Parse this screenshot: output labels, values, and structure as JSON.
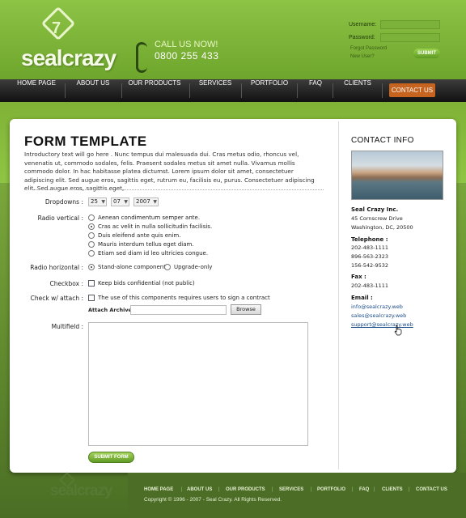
{
  "brand": {
    "name": "sealcrazy",
    "logo_glyph": "7"
  },
  "call": {
    "label": "CALL US NOW!",
    "number": "0800 255 433"
  },
  "login": {
    "username_label": "Username:",
    "password_label": "Password:",
    "forgot": "Forgot Password",
    "new_user": "New User?",
    "submit": "SUBMIT"
  },
  "nav": {
    "items": [
      {
        "label": "HOME PAGE"
      },
      {
        "label": "ABOUT US"
      },
      {
        "label": "OUR PRODUCTS"
      },
      {
        "label": "SERVICES"
      },
      {
        "label": "PORTFOLIO"
      },
      {
        "label": "FAQ"
      },
      {
        "label": "CLIENTS"
      },
      {
        "label": "CONTACT US"
      }
    ],
    "active": "CONTACT US"
  },
  "form": {
    "title": "FORM TEMPLATE",
    "intro": "Introductory text will go here . Nunc tempus dui malesuada dui. Cras metus odio, rhoncus vel, venenatis ut, commodo sodales, felis. Praesent sodales metus sit amet nulla. Vivamus mollis commodo dolor. In hac habitasse platea dictumst. Lorem ipsum dolor sit amet, consectetuer adipiscing elit. Sed augue eros, sagittis eget, rutrum eu, facilisis eu, purus. Consectetuer adipiscing elit. Sed augue eros, sagittis eget,",
    "dropdowns_label": "Dropdowns :",
    "dropdowns": {
      "day": "25",
      "month": "07",
      "year": "2007"
    },
    "radio_vertical_label": "Radio vertical :",
    "radio_vertical_options": [
      "Aenean condimentum semper ante.",
      "Cras ac velit in nulla sollicitudin facilisis.",
      "Duis eleifend ante quis enim.",
      "Mauris interdum tellus eget diam.",
      "Etiam sed diam id leo ultricies congue."
    ],
    "radio_vertical_selected": 1,
    "radio_horizontal_label": "Radio horizontal :",
    "radio_horizontal_options": [
      "Stand-alone component",
      "Upgrade-only"
    ],
    "radio_horizontal_selected": 0,
    "checkbox_label": "Checkbox :",
    "checkbox_text": "Keep bids confidential (not public)",
    "checkattach_label": "Check w/ attach :",
    "checkattach_text": "The use of this components requires users to sign a contract",
    "attach_label": "Attach Archive",
    "browse": "Browse",
    "multifield_label": "Multifield :",
    "submit": "SUBMIT FORM"
  },
  "contact": {
    "title": "CONTACT INFO",
    "company": "Seal Crazy Inc.",
    "address1": "45 Cornscrew Drive",
    "address2": "Washington, DC, 20500",
    "telephone_label": "Telephone :",
    "phones": [
      "202-483-1111",
      "896-563-2323",
      "156-542-9532"
    ],
    "fax_label": "Fax :",
    "fax": "202-483-1111",
    "email_label": "Email :",
    "emails": [
      "info@sealcrazy.web",
      "sales@sealcrazy.web",
      "support@sealcrazy.web"
    ]
  },
  "footer": {
    "links": [
      "HOME PAGE",
      "ABOUT US",
      "OUR PRODUCTS",
      "SERVICES",
      "PORTFOLIO",
      "FAQ",
      "CLIENTS",
      "CONTACT US"
    ],
    "copyright": "Copyright  ©  1996 - 2007 - Seal Crazy.   All Rights Reserved.",
    "logo": "sealcrazy"
  },
  "colors": {
    "brand_green": "#8dc446",
    "nav_active": "#c6641f",
    "link": "#1b4d8a"
  }
}
